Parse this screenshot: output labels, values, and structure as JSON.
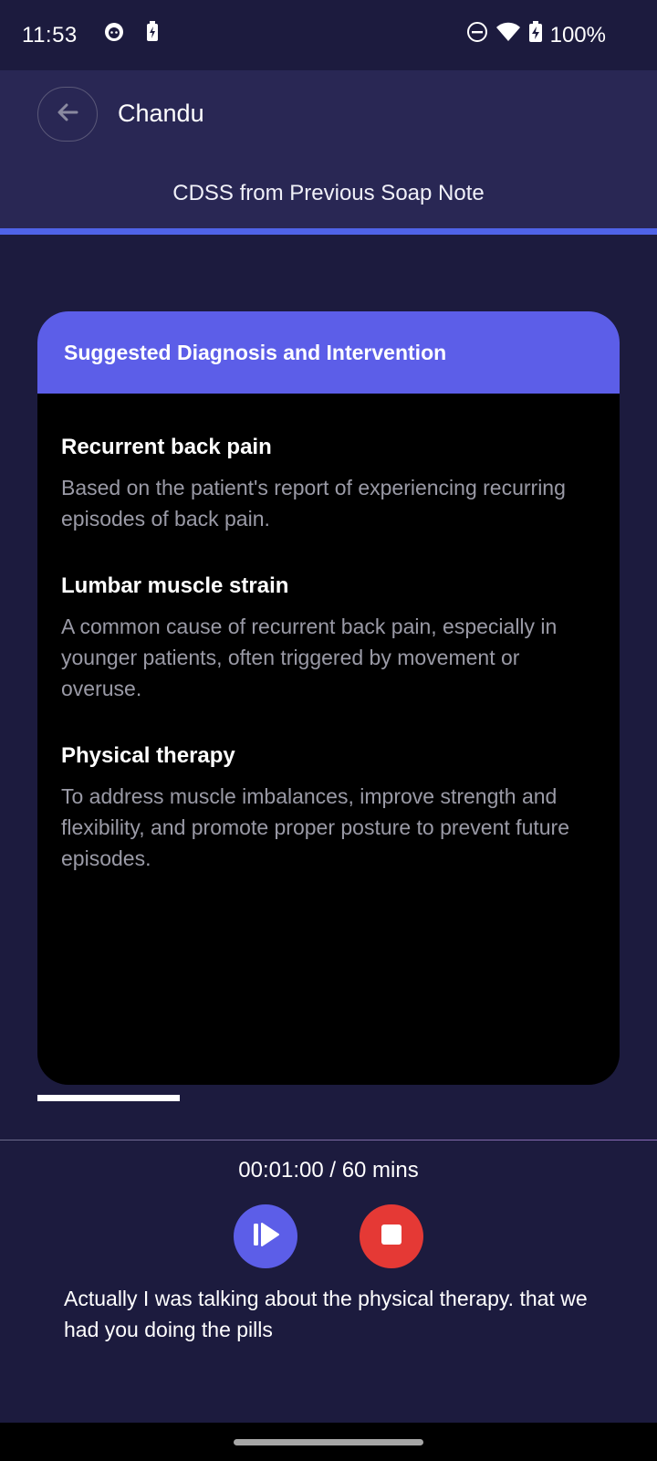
{
  "status_bar": {
    "time": "11:53",
    "battery": "100%",
    "icons": [
      "app-notification-icon",
      "battery-saver-icon",
      "do-not-disturb-icon",
      "wifi-icon",
      "battery-charging-icon"
    ]
  },
  "header": {
    "back_icon": "arrow-left-icon",
    "title": "Chandu"
  },
  "tab": {
    "label": "CDSS from Previous Soap Note",
    "indicator_color": "#4f63e8"
  },
  "card": {
    "title": "Suggested Diagnosis and Intervention",
    "header_color": "#5c5ee8",
    "items": [
      {
        "title": "Recurrent back pain",
        "description": "Based on the patient's report of experiencing recurring episodes of back pain."
      },
      {
        "title": "Lumbar muscle strain",
        "description": "A common cause of recurrent back pain, especially in younger patients, often triggered by movement or overuse."
      },
      {
        "title": "Physical therapy",
        "description": "To address muscle imbalances, improve strength and flexibility, and promote proper posture to prevent future episodes."
      }
    ]
  },
  "recording": {
    "timer": "00:01:00 / 60 mins",
    "play_icon": "resume-play-icon",
    "stop_icon": "stop-icon",
    "play_color": "#5c5ee8",
    "stop_color": "#e53935",
    "transcript": "Actually I was talking about the physical therapy. that we had you doing the pills"
  }
}
